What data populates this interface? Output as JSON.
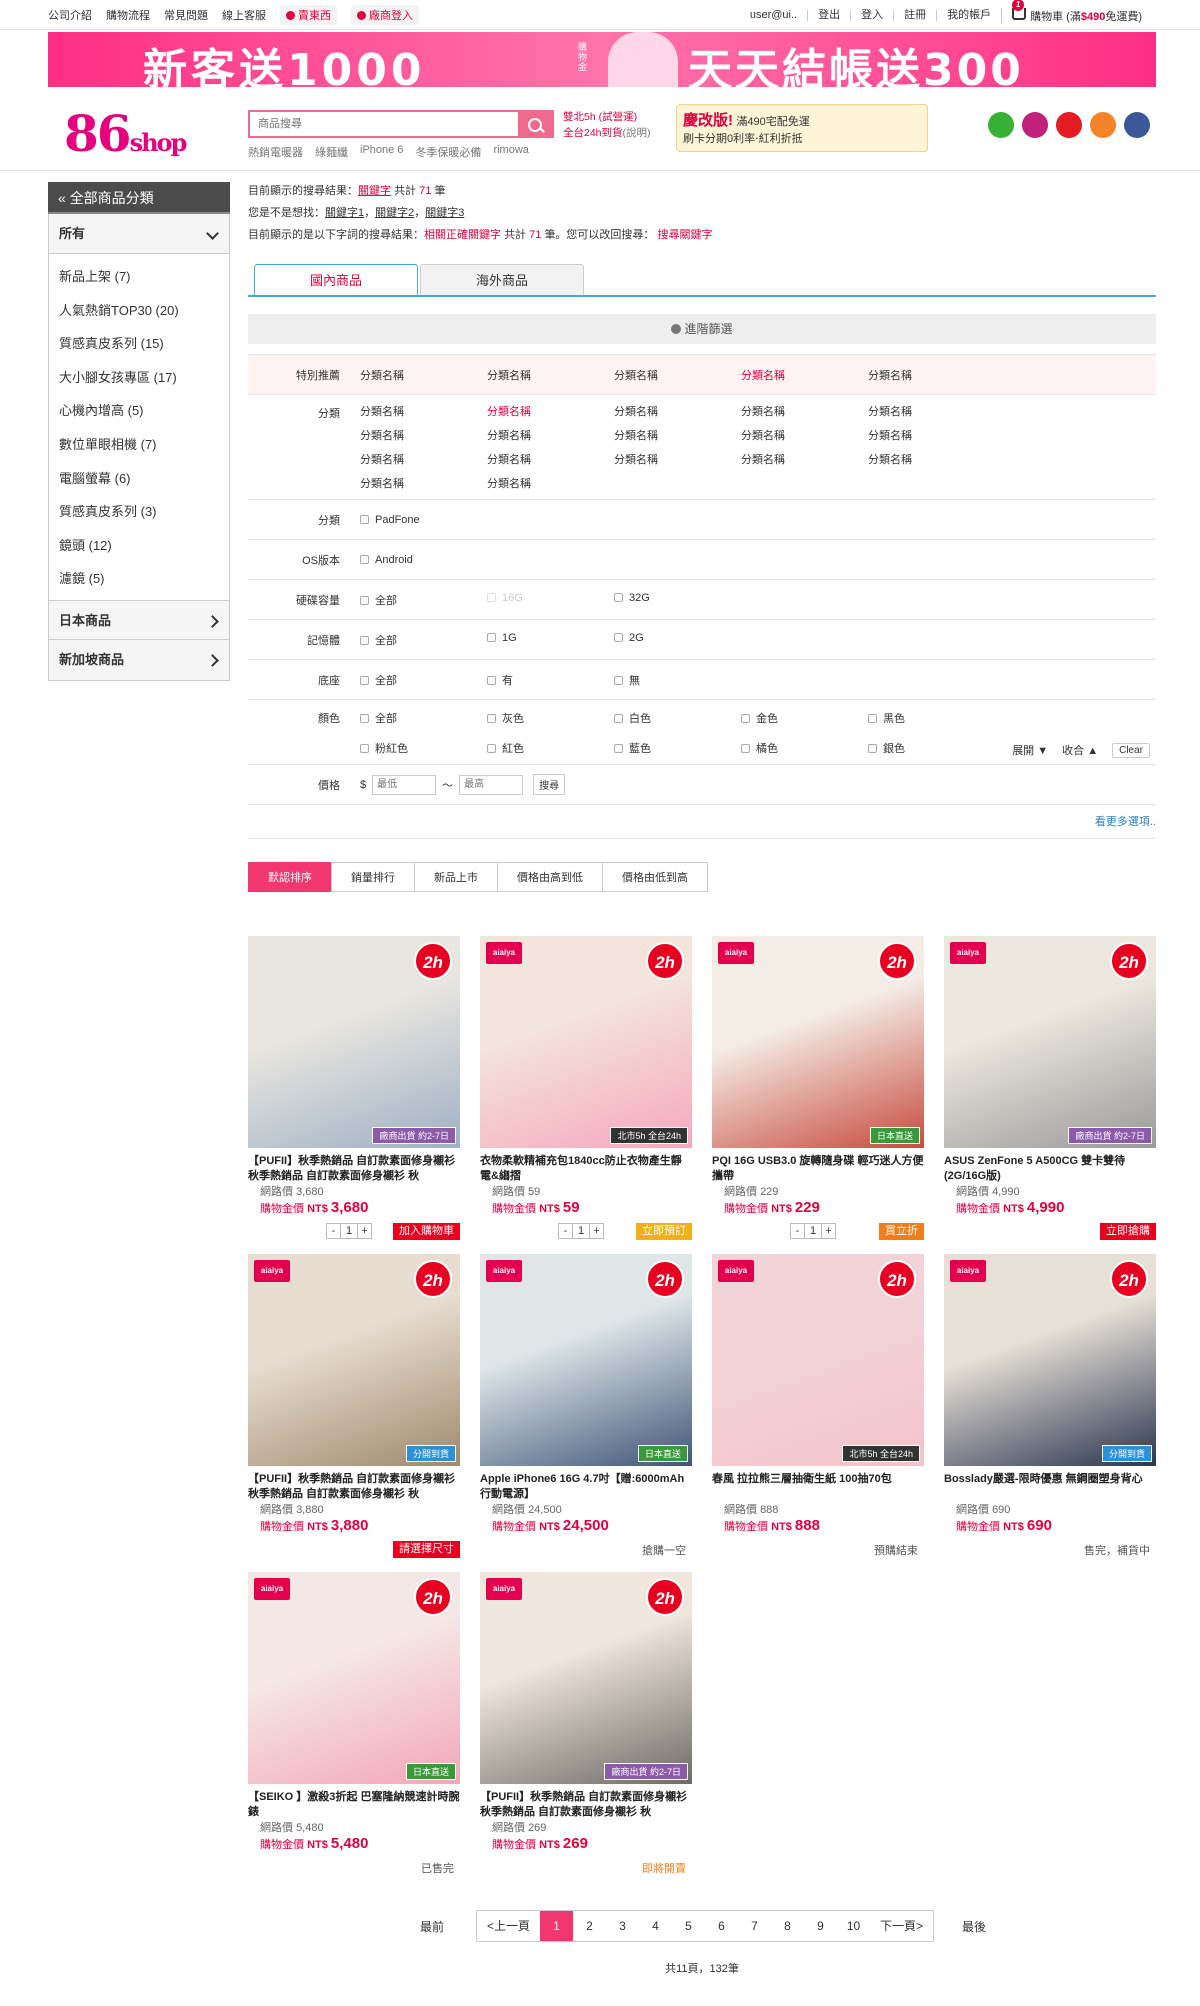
{
  "topbar": {
    "links": [
      "公司介紹",
      "購物流程",
      "常見問題",
      "線上客服"
    ],
    "pills": [
      "賣東西",
      "廠商登入"
    ],
    "right": [
      "user@ui..",
      "登出",
      "登入",
      "註冊",
      "我的帳戶"
    ],
    "cart_count": "1",
    "cart_label": "購物車",
    "cart_note_pre": "(滿",
    "cart_note_price": "$490",
    "cart_note_post": "免運費)"
  },
  "banner": {
    "left_text": "新客送1000",
    "left_small": "購物金",
    "right_text": "天天結帳送300"
  },
  "logo": {
    "main": "86",
    "sub": "shop"
  },
  "search": {
    "placeholder": "商品搜尋",
    "hot": [
      "熱銷電暖器",
      "綠麵纖",
      "iPhone 6",
      "冬季保暖必備",
      "rimowa"
    ]
  },
  "ship": {
    "line1": "雙北5h (試營運)",
    "line2": "全台24h到貨",
    "line2_note": "(說明)"
  },
  "promo": {
    "a": "慶改版!",
    "b": "滿490宅配免運",
    "c": "刷卡分期0利率‧紅利折抵"
  },
  "social": [
    {
      "name": "line-icon",
      "color": "#38b137"
    },
    {
      "name": "instagram-icon",
      "color": "#c2217b"
    },
    {
      "name": "youtube-icon",
      "color": "#e51c23"
    },
    {
      "name": "blogger-icon",
      "color": "#f58428"
    },
    {
      "name": "facebook-icon",
      "color": "#3b5998"
    }
  ],
  "sidebar": {
    "head": "« 全部商品分類",
    "section1": "所有",
    "items": [
      "新品上架 (7)",
      "人氣熱銷TOP30 (20)",
      "質感真皮系列 (15)",
      "大小腳女孩專區 (17)",
      "心機內增高 (5)",
      "數位單眼相機 (7)",
      "電腦螢幕 (6)",
      "質感真皮系列 (3)",
      "鏡頭 (12)",
      "濾鏡 (5)"
    ],
    "section2": "日本商品",
    "section3": "新加坡商品"
  },
  "results": {
    "l1_pre": "目前顯示的搜尋結果：",
    "l1_kw": "關鍵字",
    "l1_mid": "共計",
    "l1_num": "71",
    "l1_post": "筆",
    "l2_pre": "您是不是想找：",
    "l2_kws": [
      "關鍵字1",
      "關鍵字2",
      "關鍵字3"
    ],
    "l3_pre": "目前顯示的是以下字詞的搜尋結果：",
    "l3_kw": "相關正確關鍵字",
    "l3_mid": "共計",
    "l3_num": "71",
    "l3_post": "筆。您可以改回搜尋：",
    "l3_kw2": "搜尋關鍵字"
  },
  "tabs": [
    "國內商品",
    "海外商品"
  ],
  "adv_filter": "進階篩選",
  "filters": {
    "featured_label": "特別推薦",
    "featured": [
      "分類名稱",
      "分類名稱",
      "分類名稱",
      "分類名稱",
      "分類名稱"
    ],
    "cat_label": "分類",
    "cats": [
      "分類名稱",
      "分類名稱",
      "分類名稱",
      "分類名稱",
      "分類名稱",
      "分類名稱",
      "分類名稱",
      "分類名稱",
      "分類名稱",
      "分類名稱",
      "分類名稱",
      "分類名稱",
      "分類名稱",
      "分類名稱",
      "分類名稱",
      "分類名稱",
      "分類名稱"
    ],
    "cat2_label": "分類",
    "cat2": [
      "PadFone"
    ],
    "os_label": "OS版本",
    "os": [
      "Android"
    ],
    "disk_label": "硬碟容量",
    "disk": [
      "全部",
      "16G",
      "32G"
    ],
    "mem_label": "記憶體",
    "mem": [
      "全部",
      "1G",
      "2G"
    ],
    "base_label": "底座",
    "base": [
      "全部",
      "有",
      "無"
    ],
    "color_label": "顏色",
    "colors": [
      "全部",
      "灰色",
      "白色",
      "金色",
      "黑色",
      "粉紅色",
      "紅色",
      "藍色",
      "橘色",
      "銀色"
    ],
    "expand": "展開",
    "collapse": "收合",
    "clear": "Clear",
    "price_label": "價格",
    "currency": "$",
    "min_ph": "最低",
    "tilde": "～",
    "max_ph": "最高",
    "search_btn": "搜尋",
    "more": "看更多選項.."
  },
  "sorts": [
    "默認排序",
    "銷量排行",
    "新品上市",
    "價格由高到低",
    "價格由低到高"
  ],
  "labels": {
    "net": "網路價",
    "buy": "購物金價",
    "nt": "NT$"
  },
  "products": [
    {
      "title": "【PUFII】秋季熱銷品 自訂款素面修身襯衫 秋季熱銷品 自訂款素面修身襯衫 秋",
      "net": "3,680",
      "price": "3,680",
      "tag": "廠商出貨 約2-7日",
      "tag_color": "#8b5aa8",
      "brand": false,
      "qty": "1",
      "btn": "加入購物車",
      "btn_color": "#e7001f",
      "status": "",
      "img_colors": [
        "#e9e6e0",
        "#9fb0c4"
      ]
    },
    {
      "title": "衣物柔軟精補充包1840cc防止衣物產生靜電&縐摺",
      "net": "59",
      "price": "59",
      "tag": "北市5h 全台24h",
      "tag_color": "#333",
      "brand": true,
      "qty": "1",
      "btn": "立即預訂",
      "btn_color": "#f0b01c",
      "status": "",
      "img_colors": [
        "#f3e4dc",
        "#f6a7bd"
      ]
    },
    {
      "title": "PQI 16G USB3.0 旋轉隨身碟 輕巧迷人方便攜帶",
      "net": "229",
      "price": "229",
      "tag": "日本直送",
      "tag_color": "#3a9a3a",
      "brand": true,
      "qty": "1",
      "btn": "買立折",
      "btn_color": "#f27d1b",
      "status": "",
      "img_colors": [
        "#f4ede6",
        "#c84b3e"
      ]
    },
    {
      "title": "ASUS ZenFone 5 A500CG 雙卡雙待(2G/16G版)",
      "net": "4,990",
      "price": "4,990",
      "tag": "廠商出貨 約2-7日",
      "tag_color": "#8b5aa8",
      "brand": true,
      "qty": "",
      "btn": "立即搶購",
      "btn_color": "#e7001f",
      "status": "",
      "img_colors": [
        "#ece7df",
        "#9a9a9a"
      ]
    },
    {
      "title": "【PUFII】秋季熱銷品 自訂款素面修身襯衫 秋季熱銷品 自訂款素面修身襯衫 秋",
      "net": "3,880",
      "price": "3,880",
      "tag": "分開到貨",
      "tag_color": "#2d8fd5",
      "brand": true,
      "qty": "",
      "btn": "請選擇尺寸",
      "btn_color": "#e7001f",
      "status": "",
      "img_colors": [
        "#e7ddd0",
        "#a08a6e"
      ]
    },
    {
      "title": "Apple iPhone6 16G 4.7吋【贈:6000mAh 行動電源】",
      "net": "24,500",
      "price": "24,500",
      "tag": "日本直送",
      "tag_color": "#3a9a3a",
      "brand": true,
      "qty": "",
      "btn": "",
      "btn_color": "",
      "status": "搶購一空",
      "img_colors": [
        "#dfe6e8",
        "#3f5678"
      ]
    },
    {
      "title": "春風 拉拉熊三層抽衛生紙 100抽70包",
      "net": "888",
      "price": "888",
      "tag": "北市5h 全台24h",
      "tag_color": "#333",
      "brand": true,
      "qty": "",
      "btn": "",
      "btn_color": "",
      "status": "預購結束",
      "img_colors": [
        "#f2d4d8",
        "#f4c2cb"
      ]
    },
    {
      "title": "Bosslady嚴選-限時優惠 無鋼圈塑身背心",
      "net": "690",
      "price": "690",
      "tag": "分開到貨",
      "tag_color": "#2d8fd5",
      "brand": true,
      "qty": "",
      "btn": "",
      "btn_color": "",
      "status": "售完，補貨中",
      "img_colors": [
        "#e6e0d6",
        "#2c3550"
      ]
    },
    {
      "title": "【SEIKO 】激殺3折起 巴塞隆納競速計時腕錶",
      "net": "5,480",
      "price": "5,480",
      "tag": "日本直送",
      "tag_color": "#3a9a3a",
      "brand": true,
      "qty": "",
      "btn": "",
      "btn_color": "",
      "status": "已售完",
      "img_colors": [
        "#f4e8e6",
        "#f3a7b8"
      ]
    },
    {
      "title": "【PUFII】秋季熱銷品 自訂款素面修身襯衫 秋季熱銷品 自訂款素面修身襯衫 秋",
      "net": "269",
      "price": "269",
      "tag": "廠商出貨 約2-7日",
      "tag_color": "#8b5aa8",
      "brand": true,
      "qty": "",
      "btn": "",
      "btn_color": "",
      "status": "即將開賣",
      "status_red": true,
      "img_colors": [
        "#efe6dc",
        "#6e6b66"
      ]
    }
  ],
  "pager": {
    "first": "最前",
    "prev": "<上一頁",
    "pages": [
      "1",
      "2",
      "3",
      "4",
      "5",
      "6",
      "7",
      "8",
      "9",
      "10"
    ],
    "next": "下一頁>",
    "last": "最後",
    "total": "共11頁，132筆"
  }
}
